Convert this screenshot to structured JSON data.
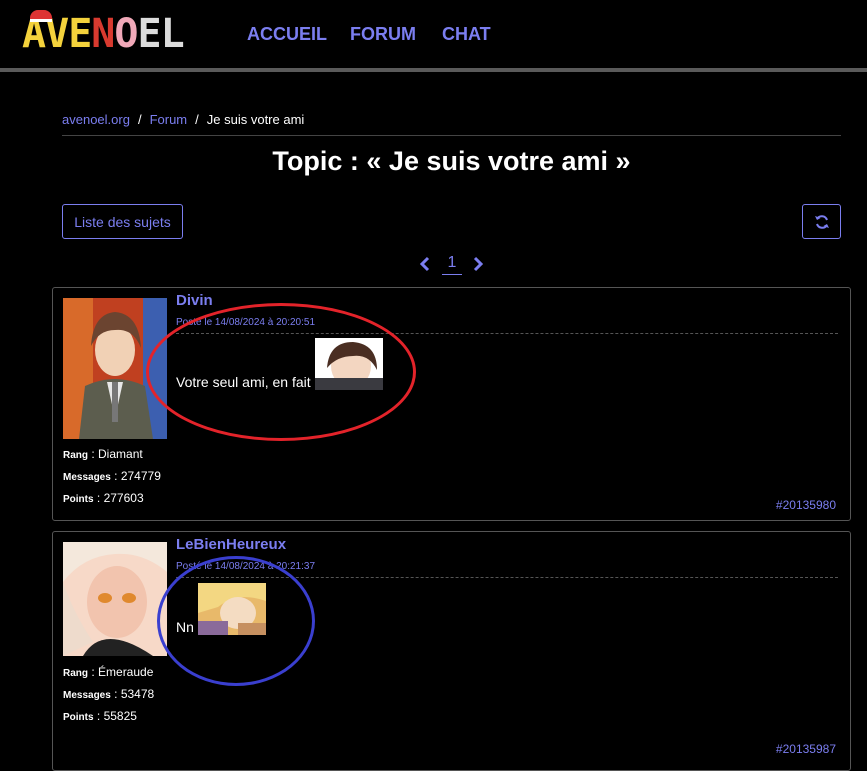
{
  "header": {
    "logo_letters": [
      "A",
      "V",
      "E",
      "N",
      "O",
      "E",
      "L"
    ],
    "logo_colors": [
      "#f4d23c",
      "#f4d23c",
      "#f4d23c",
      "#d83a2f",
      "#f0a8b8",
      "#dcdcdc",
      "#dcdcdc"
    ],
    "nav": {
      "home": "ACCUEIL",
      "forum": "FORUM",
      "chat": "CHAT"
    }
  },
  "breadcrumb": {
    "root": "avenoel.org",
    "sep": "/",
    "forum": "Forum",
    "current": "Je suis votre ami"
  },
  "page_title": "Topic : « Je suis votre ami »",
  "toolbar": {
    "list_label": "Liste des sujets",
    "refresh_icon": "refresh-icon"
  },
  "pagination": {
    "current": "1",
    "prev_icon": "chevron-left-icon",
    "next_icon": "chevron-right-icon"
  },
  "posts": [
    {
      "author": "Divin",
      "date": "Posté le 14/08/2024 à 20:20:51",
      "text": "Votre seul ami, en fait",
      "rank_label": "Rang",
      "rank": "Diamant",
      "messages_label": "Messages",
      "messages": "274779",
      "points_label": "Points",
      "points": "277603",
      "id": "#20135980"
    },
    {
      "author": "LeBienHeureux",
      "date": "Posté le 14/08/2024 à 20:21:37",
      "text": "Nn",
      "rank_label": "Rang",
      "rank": "Émeraude",
      "messages_label": "Messages",
      "messages": "53478",
      "points_label": "Points",
      "points": "55825",
      "id": "#20135987"
    }
  ],
  "colors": {
    "accent": "#7b7ef0",
    "annotation_red": "#e3232a",
    "annotation_blue": "#3a3fcf"
  }
}
